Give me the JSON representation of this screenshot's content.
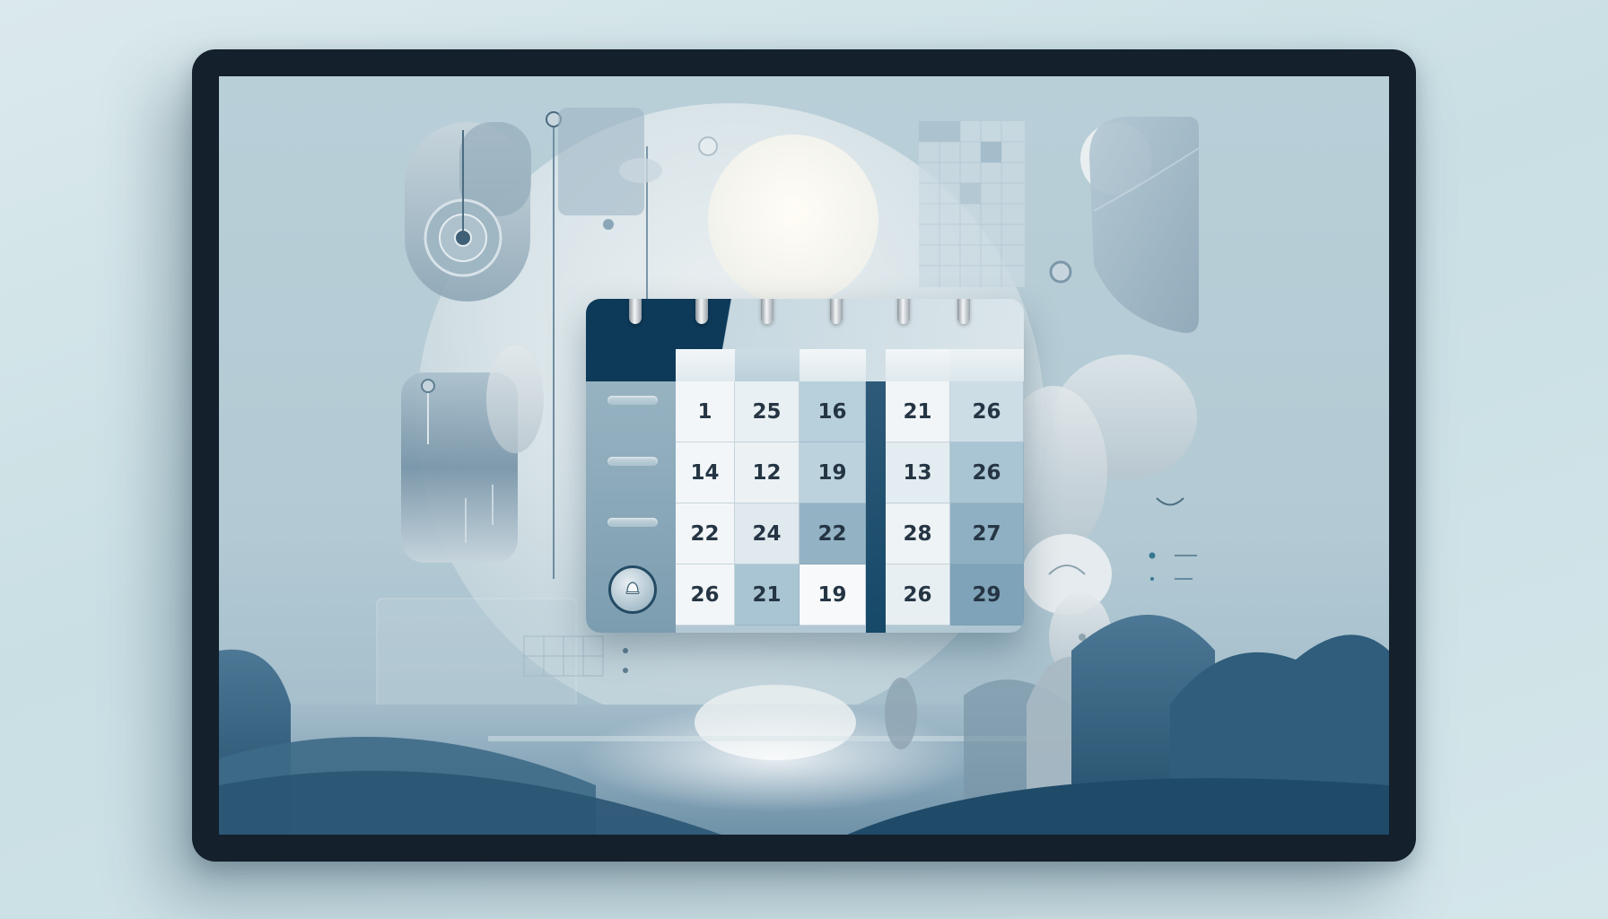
{
  "calendar": {
    "rows": [
      [
        "1",
        "25",
        "16",
        "21",
        "26"
      ],
      [
        "14",
        "12",
        "19",
        "13",
        "26"
      ],
      [
        "22",
        "24",
        "22",
        "28",
        "27"
      ],
      [
        "26",
        "21",
        "19",
        "26",
        "29"
      ]
    ]
  },
  "colors": {
    "frame": "#14202b",
    "header_dark": "#0e3a59",
    "accent": "#2e5a78",
    "screen_bg": "#b9cfd8",
    "hill_dark": "#3a6a88"
  },
  "icons": {
    "side_button": "bell-icon",
    "binding": "ring-binder"
  }
}
